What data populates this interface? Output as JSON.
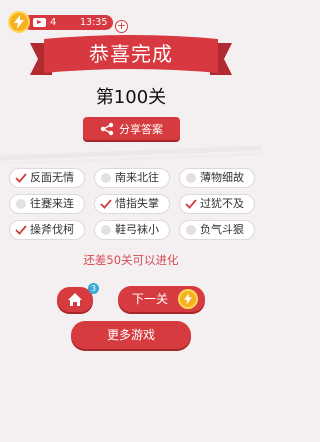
{
  "status_bar": {
    "energy_count": "4",
    "timer": "13:35",
    "add_label": "+"
  },
  "result": {
    "title": "恭喜完成",
    "level": "第100关",
    "share_label": "分享答案"
  },
  "idioms": [
    {
      "text": "反面无情",
      "checked": true
    },
    {
      "text": "南来北往",
      "checked": false
    },
    {
      "text": "薄物细故",
      "checked": false
    },
    {
      "text": "往蹇来连",
      "checked": false
    },
    {
      "text": "惜指失掌",
      "checked": true
    },
    {
      "text": "过犹不及",
      "checked": true
    },
    {
      "text": "操斧伐柯",
      "checked": true
    },
    {
      "text": "鞋弓袜小",
      "checked": false
    },
    {
      "text": "负气斗狠",
      "checked": false
    }
  ],
  "notice": "还差50关可以进化",
  "actions": {
    "home_badge": "3",
    "next_label": "下一关",
    "more_label": "更多游戏"
  },
  "colors": {
    "accent": "#d63c3f",
    "energy": "#f6b11d",
    "background": "#f4f0f1"
  }
}
